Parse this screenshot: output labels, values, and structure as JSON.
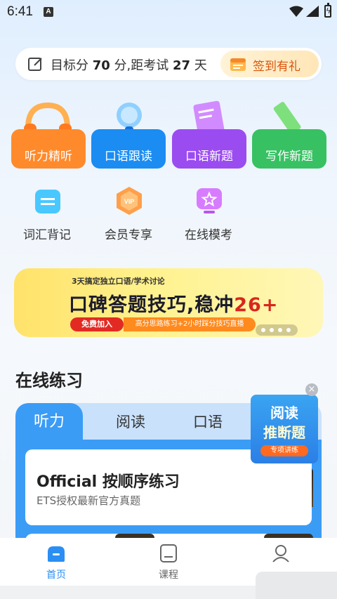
{
  "status_bar": {
    "time": "6:41",
    "notification": "A"
  },
  "target": {
    "prefix": "目标分 ",
    "score": "70",
    "middle": " 分,距考试 ",
    "days": "27",
    "suffix": " 天",
    "checkin_label": "签到有礼"
  },
  "features": [
    {
      "label": "听力精听",
      "color": "#ff8a2b"
    },
    {
      "label": "口语跟读",
      "color": "#1b8cf2"
    },
    {
      "label": "口语新题",
      "color": "#9b4cf0"
    },
    {
      "label": "写作新题",
      "color": "#37c163"
    }
  ],
  "quick_entries": [
    {
      "label": "词汇背记"
    },
    {
      "label": "会员专享",
      "badge": "VIP"
    },
    {
      "label": "在线模考"
    }
  ],
  "banner": {
    "subtitle": "3天搞定独立口语/学术讨论",
    "headline": "口碑答题技巧,稳冲",
    "score": "26+",
    "cta": "免费加入",
    "desc": "高分思路练习+2小时踩分技巧直播"
  },
  "practice": {
    "section_title": "在线练习",
    "tabs": [
      "听力",
      "阅读",
      "口语"
    ],
    "active_tab": 0,
    "card_title": "Official 按顺序练习",
    "card_subtitle": "ETS授权最新官方真题"
  },
  "float_ad": {
    "line1": "阅读",
    "line2": "推断题",
    "tag": "专项讲练",
    "close": "×"
  },
  "bottom_nav": [
    {
      "label": "首页",
      "active": true
    },
    {
      "label": "课程",
      "active": false
    },
    {
      "label": "",
      "active": false
    }
  ]
}
